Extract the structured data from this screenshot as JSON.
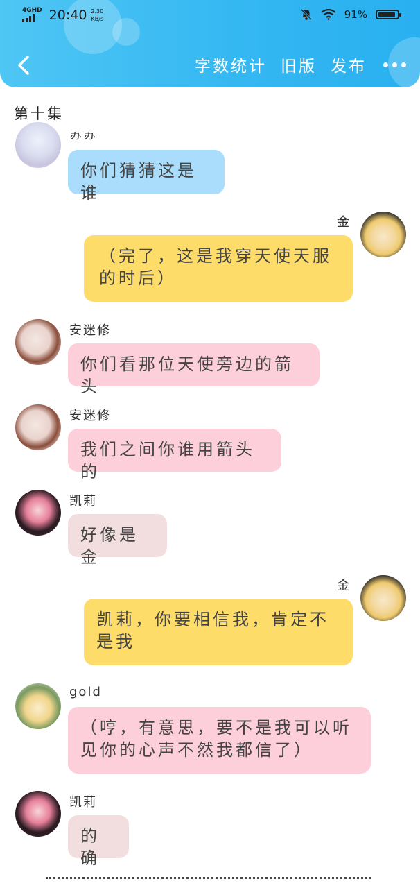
{
  "statusbar": {
    "network": "4GHD",
    "time": "20:40",
    "speed_value": "2.30",
    "speed_unit": "KB/s",
    "battery_percent": "91%",
    "battery_level": 0.91
  },
  "toolbar": {
    "word_count": "字数统计",
    "old_version": "旧版",
    "publish": "发布"
  },
  "chapter_title": "第十集",
  "messages": [
    {
      "sender": "苏苏",
      "text": "你们猜猜这是谁",
      "side": "left",
      "color": "#aadcfb"
    },
    {
      "sender": "金",
      "text": "（完了，这是我穿天使天服的时后）",
      "side": "right",
      "color": "#fedc6a"
    },
    {
      "sender": "安迷修",
      "text": "你们看那位天使旁边的箭头",
      "side": "left",
      "color": "#fdcfdb"
    },
    {
      "sender": "安迷修",
      "text": "我们之间你谁用箭头的",
      "side": "left",
      "color": "#fdcfdb"
    },
    {
      "sender": "凯莉",
      "text": "好像是金",
      "side": "left",
      "color": "#f2dede"
    },
    {
      "sender": "金",
      "text": "凯莉，你要相信我，肯定不是我",
      "side": "right",
      "color": "#fedc6a"
    },
    {
      "sender": "gold",
      "text": "（哼，有意思，要不是我可以听见你的心声不然我都信了）",
      "side": "left",
      "color": "#fdcfdb"
    },
    {
      "sender": "凯莉",
      "text": "的确",
      "side": "left",
      "color": "#f2dede"
    }
  ],
  "colors": {
    "header_start": "#4fc6f4",
    "header_end": "#29b0f0"
  },
  "icons": [
    "back-arrow-icon",
    "more-dots-icon",
    "mute-bell-icon",
    "wifi-icon",
    "battery-icon",
    "signal-icon"
  ]
}
